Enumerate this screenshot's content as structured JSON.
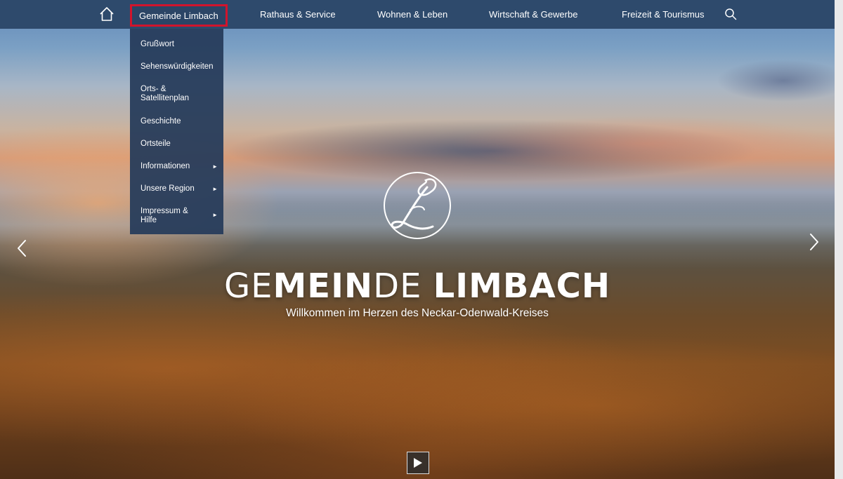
{
  "nav": {
    "home_icon": "home-icon",
    "items": [
      {
        "label": "Gemeinde Limbach",
        "active": true
      },
      {
        "label": "Rathaus & Service"
      },
      {
        "label": "Wohnen & Leben"
      },
      {
        "label": "Wirtschaft & Gewerbe"
      },
      {
        "label": "Freizeit & Tourismus"
      }
    ],
    "search_icon": "search-icon",
    "active_border_color": "#d2142c",
    "bar_color": "#2e4a6c"
  },
  "dropdown": {
    "items": [
      {
        "label": "Grußwort"
      },
      {
        "label": "Sehenswürdigkeiten"
      },
      {
        "label": "Orts- & Satellitenplan"
      },
      {
        "label": "Geschichte"
      },
      {
        "label": "Ortsteile"
      },
      {
        "label": "Informationen",
        "has_submenu": true
      },
      {
        "label": "Unsere Region",
        "has_submenu": true
      },
      {
        "label": "Impressum & Hilfe",
        "has_submenu": true
      }
    ],
    "submenu_arrow": "►"
  },
  "hero": {
    "logo_icon": "script-l-logo-icon",
    "title_parts": [
      {
        "text": "GE",
        "weight": "light"
      },
      {
        "text": "MEIN",
        "weight": "bold"
      },
      {
        "text": "DE ",
        "weight": "light"
      },
      {
        "text": "LIMBACH",
        "weight": "bold"
      }
    ],
    "subtitle": "Willkommen im Herzen des Neckar-Odenwald-Kreises",
    "prev_icon": "chevron-left-icon",
    "next_icon": "chevron-right-icon",
    "play_icon": "play-icon"
  }
}
